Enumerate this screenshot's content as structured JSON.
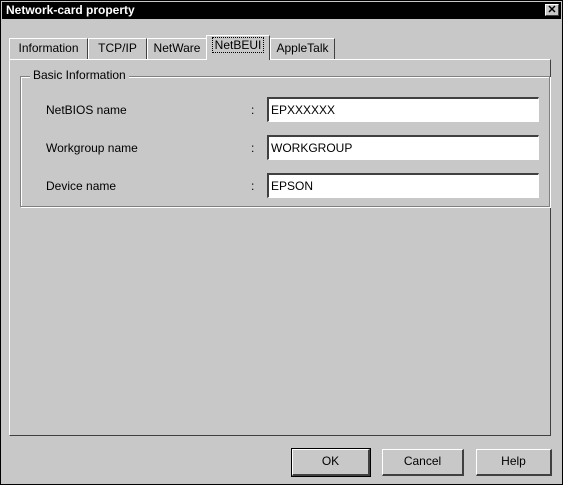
{
  "window": {
    "title": "Network-card property",
    "close_glyph": "✕"
  },
  "tabs": [
    {
      "label": "Information"
    },
    {
      "label": "TCP/IP"
    },
    {
      "label": "NetWare"
    },
    {
      "label": "NetBEUI",
      "active": true
    },
    {
      "label": "AppleTalk"
    }
  ],
  "group": {
    "title": "Basic Information",
    "fields": [
      {
        "label": "NetBIOS name",
        "colon": ":",
        "value": "EPXXXXXX"
      },
      {
        "label": "Workgroup name",
        "colon": ":",
        "value": "WORKGROUP"
      },
      {
        "label": "Device name",
        "colon": ":",
        "value": "EPSON"
      }
    ]
  },
  "buttons": {
    "ok": "OK",
    "cancel": "Cancel",
    "help": "Help"
  },
  "colors": {
    "dialog_face": "#c8c8c8",
    "titlebar": "#000000",
    "title_text": "#ffffff"
  }
}
